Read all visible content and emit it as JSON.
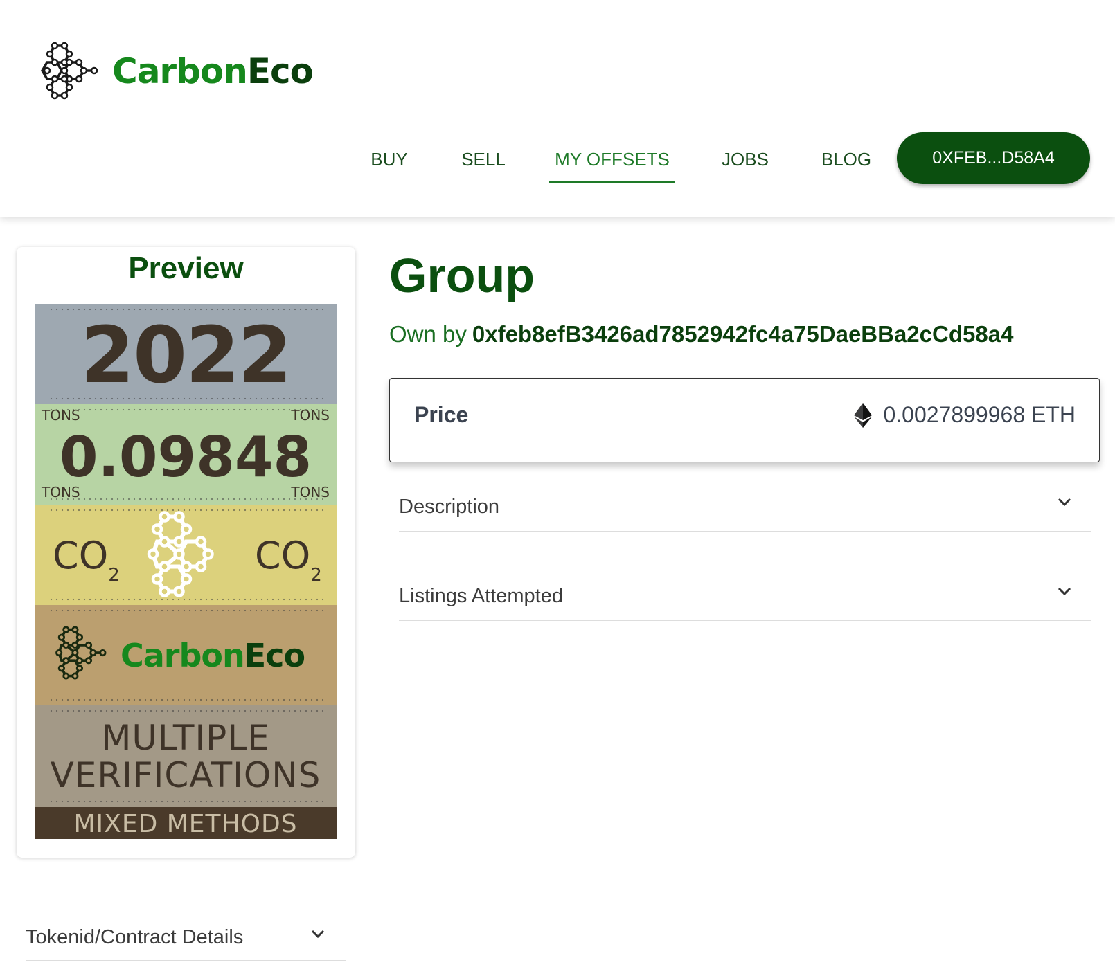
{
  "brand": {
    "name_part1": "Carbon",
    "name_part2": "Eco"
  },
  "nav": {
    "items": [
      {
        "label": "BUY"
      },
      {
        "label": "SELL"
      },
      {
        "label": "MY OFFSETS",
        "active": true
      },
      {
        "label": "JOBS"
      },
      {
        "label": "BLOG"
      }
    ],
    "wallet_label": "0XFEB...D58A4"
  },
  "preview": {
    "title": "Preview",
    "year": "2022",
    "tons_label": "TONS",
    "tons_value": "0.09848",
    "co2_text": "CO",
    "co2_sub": "2",
    "verification_line1": "MULTIPLE",
    "verification_line2": "VERIFICATIONS",
    "method": "MIXED METHODS"
  },
  "token_details": {
    "label": "Tokenid/Contract Details"
  },
  "item": {
    "title": "Group",
    "owner_prefix": "Own by",
    "owner_address": "0xfeb8efB3426ad7852942fc4a75DaeBBa2cCd58a4"
  },
  "price": {
    "label": "Price",
    "value": "0.0027899968 ETH"
  },
  "accordions": {
    "description": "Description",
    "listings": "Listings Attempted"
  },
  "colors": {
    "brand_green": "#16881d",
    "dark_green": "#0b4f0f"
  }
}
